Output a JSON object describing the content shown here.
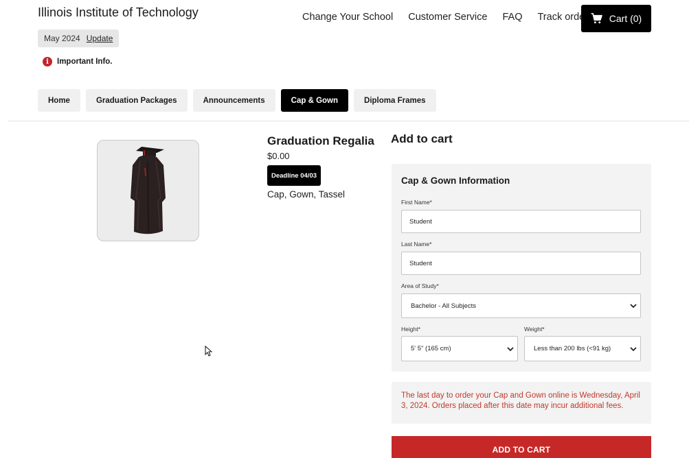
{
  "header": {
    "school_name": "Illinois Institute of Technology",
    "term": "May 2024",
    "update_label": "Update",
    "important_label": "Important Info."
  },
  "topnav": {
    "links": [
      "Change Your School",
      "Customer Service",
      "FAQ",
      "Track order"
    ],
    "cart_label": "Cart (0)"
  },
  "tabs": [
    {
      "label": "Home",
      "active": false
    },
    {
      "label": "Graduation Packages",
      "active": false
    },
    {
      "label": "Announcements",
      "active": false
    },
    {
      "label": "Cap & Gown",
      "active": true
    },
    {
      "label": "Diploma Frames",
      "active": false
    }
  ],
  "product": {
    "title": "Graduation Regalia",
    "price": "$0.00",
    "deadline": "Deadline 04/03",
    "description": "Cap, Gown, Tassel"
  },
  "form": {
    "heading": "Add to cart",
    "panel_title": "Cap & Gown Information",
    "first_name_label": "First Name*",
    "first_name_value": "Student",
    "last_name_label": "Last Name*",
    "last_name_value": "Student",
    "area_label": "Area of Study*",
    "area_value": "Bachelor - All Subjects",
    "height_label": "Height*",
    "height_value": "5' 5\" (165 cm)",
    "weight_label": "Weight*",
    "weight_value": "Less than 200 lbs (<91 kg)"
  },
  "notice": "The last day to order your Cap and Gown online is Wednesday, April 3, 2024. Orders placed after this date may incur additional fees.",
  "add_button_label": "ADD TO CART",
  "colors": {
    "accent_red": "#c62828",
    "notice_red": "#c0392b",
    "active_tab": "#000000",
    "panel_bg": "#f3f3f3"
  }
}
